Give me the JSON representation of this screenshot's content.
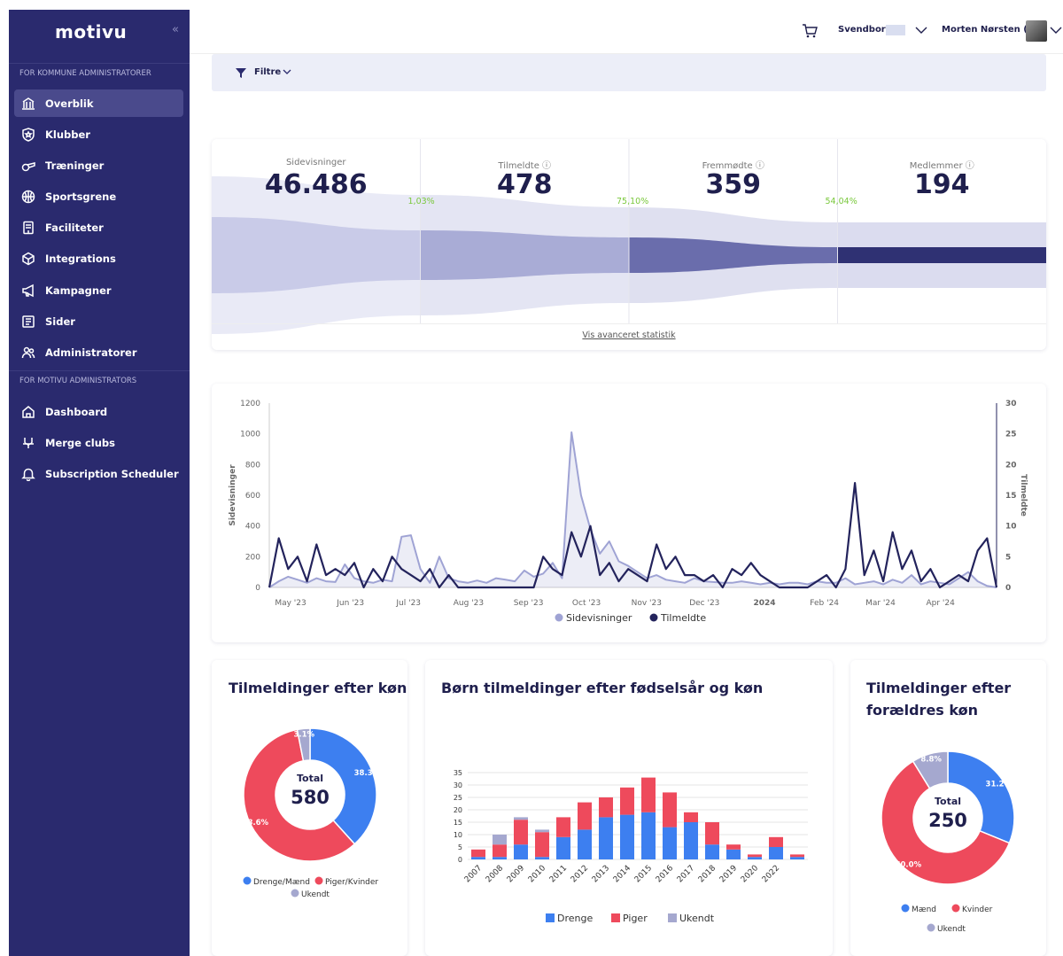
{
  "sidebar": {
    "logo": "motivu",
    "section_municipal": "FOR KOMMUNE ADMINISTRATORER",
    "section_motivu": "FOR MOTIVU ADMINISTRATORS",
    "items": [
      {
        "label": "Overblik",
        "icon": "bank-icon",
        "active": true
      },
      {
        "label": "Klubber",
        "icon": "shield-icon"
      },
      {
        "label": "Træninger",
        "icon": "whistle-icon"
      },
      {
        "label": "Sportsgrene",
        "icon": "ball-icon"
      },
      {
        "label": "Faciliteter",
        "icon": "building-icon"
      },
      {
        "label": "Integrations",
        "icon": "cube-icon"
      },
      {
        "label": "Kampagner",
        "icon": "megaphone-icon"
      },
      {
        "label": "Sider",
        "icon": "pages-icon"
      },
      {
        "label": "Administratorer",
        "icon": "users-icon"
      },
      {
        "label": "Dashboard",
        "icon": "home-icon"
      },
      {
        "label": "Merge clubs",
        "icon": "merge-icon"
      },
      {
        "label": "Subscription Scheduler",
        "icon": "bell-icon"
      }
    ]
  },
  "topbar": {
    "municipality": "Svendborg",
    "user": "Morten Nørsten (..."
  },
  "filter": {
    "label": "Filtre"
  },
  "funnel": {
    "stats": [
      {
        "label": "Sidevisninger",
        "value": "46.486"
      },
      {
        "label": "Tilmeldte",
        "value": "478"
      },
      {
        "label": "Fremmødte",
        "value": "359"
      },
      {
        "label": "Medlemmer",
        "value": "194"
      }
    ],
    "conversions": [
      "1,03%",
      "75,10%",
      "54,04%"
    ],
    "link": "Vis avanceret statistik"
  },
  "timeline": {
    "left_axis_label": "Sidevisninger",
    "right_axis_label": "Tilmeldte",
    "left_ticks": [
      "1200",
      "1000",
      "800",
      "600",
      "400",
      "200",
      "0"
    ],
    "right_ticks": [
      "30",
      "25",
      "20",
      "15",
      "10",
      "5",
      "0"
    ],
    "x_ticks": [
      "May '23",
      "Jun '23",
      "Jul '23",
      "Aug '23",
      "Sep '23",
      "Oct '23",
      "Nov '23",
      "Dec '23",
      "2024",
      "Feb '24",
      "Mar '24",
      "Apr '24"
    ],
    "legend": [
      "Sidevisninger",
      "Tilmeldte"
    ],
    "colors": {
      "views": "#9fa3d4",
      "signups": "#23235c"
    }
  },
  "chart_data": [
    {
      "type": "line",
      "x_start": "2023-04-20",
      "x_end": "2024-04-30",
      "series": [
        {
          "name": "Sidevisninger",
          "axis": "left",
          "values": [
            0,
            40,
            70,
            50,
            30,
            60,
            40,
            35,
            150,
            60,
            40,
            30,
            50,
            40,
            330,
            340,
            120,
            30,
            200,
            60,
            40,
            30,
            45,
            30,
            60,
            50,
            40,
            110,
            70,
            90,
            160,
            60,
            1010,
            600,
            380,
            220,
            300,
            170,
            140,
            100,
            60,
            80,
            50,
            40,
            30,
            60,
            40,
            35,
            30,
            30,
            40,
            30,
            20,
            30,
            20,
            30,
            30,
            20,
            40,
            30,
            30,
            60,
            20,
            30,
            40,
            20,
            50,
            30,
            80,
            20,
            40,
            30,
            20,
            60,
            100,
            40,
            10,
            0
          ]
        },
        {
          "name": "Tilmeldte",
          "axis": "right",
          "values": [
            0,
            8,
            3,
            5,
            1,
            7,
            2,
            3,
            2,
            4,
            0,
            3,
            1,
            5,
            3,
            2,
            1,
            3,
            0,
            2,
            0,
            0,
            0,
            0,
            0,
            0,
            0,
            0,
            0,
            5,
            3,
            2,
            9,
            5,
            10,
            2,
            4,
            1,
            3,
            2,
            1,
            7,
            3,
            5,
            2,
            2,
            1,
            2,
            0,
            3,
            2,
            4,
            2,
            1,
            0,
            0,
            0,
            0,
            1,
            2,
            0,
            3,
            17,
            2,
            6,
            1,
            9,
            3,
            6,
            1,
            3,
            0,
            1,
            2,
            1,
            6,
            8,
            0
          ]
        }
      ],
      "ylim_left": [
        0,
        1200
      ],
      "ylim_right": [
        0,
        30
      ]
    },
    {
      "type": "pie",
      "title": "Tilmeldinger efter køn",
      "center_label": "Total",
      "center_value": "580",
      "labels": [
        "Drenge/Mænd",
        "Piger/Kvinder",
        "Ukendt"
      ],
      "values": [
        38.3,
        58.6,
        3.1
      ],
      "value_labels": [
        "38.3%",
        "58.6%",
        "3.1%"
      ],
      "colors": [
        "#3d7ff0",
        "#ee4a5c",
        "#a5a8cf"
      ]
    },
    {
      "type": "bar",
      "title": "Børn tilmeldinger efter fødselsår og køn",
      "categories": [
        "2007",
        "2008",
        "2009",
        "2010",
        "2011",
        "2012",
        "2013",
        "2014",
        "2015",
        "2016",
        "2017",
        "2018",
        "2019",
        "2020",
        "2022"
      ],
      "series": [
        {
          "name": "Drenge",
          "values": [
            1,
            1,
            6,
            1,
            9,
            12,
            17,
            18,
            19,
            13,
            15,
            6,
            4,
            1,
            5,
            1
          ]
        },
        {
          "name": "Piger",
          "values": [
            3,
            5,
            10,
            10,
            8,
            11,
            8,
            11,
            14,
            14,
            4,
            9,
            2,
            1,
            4,
            1
          ]
        },
        {
          "name": "Ukendt",
          "values": [
            0,
            4,
            1,
            1,
            0,
            0,
            0,
            0,
            0,
            0,
            0,
            0,
            0,
            0,
            0,
            0
          ]
        }
      ],
      "yticks": [
        "0",
        "5",
        "10",
        "15",
        "20",
        "25",
        "30",
        "35"
      ],
      "ylim": [
        0,
        35
      ],
      "colors": [
        "#3d7ff0",
        "#ee4a5c",
        "#a5a8cf"
      ]
    },
    {
      "type": "pie",
      "title": "Tilmeldinger efter forældres køn",
      "center_label": "Total",
      "center_value": "250",
      "labels": [
        "Mænd",
        "Kvinder",
        "Ukendt"
      ],
      "values": [
        31.2,
        60.0,
        8.8
      ],
      "value_labels": [
        "31.2%",
        "60.0%",
        "8.8%"
      ],
      "colors": [
        "#3d7ff0",
        "#ee4a5c",
        "#a5a8cf"
      ]
    }
  ]
}
